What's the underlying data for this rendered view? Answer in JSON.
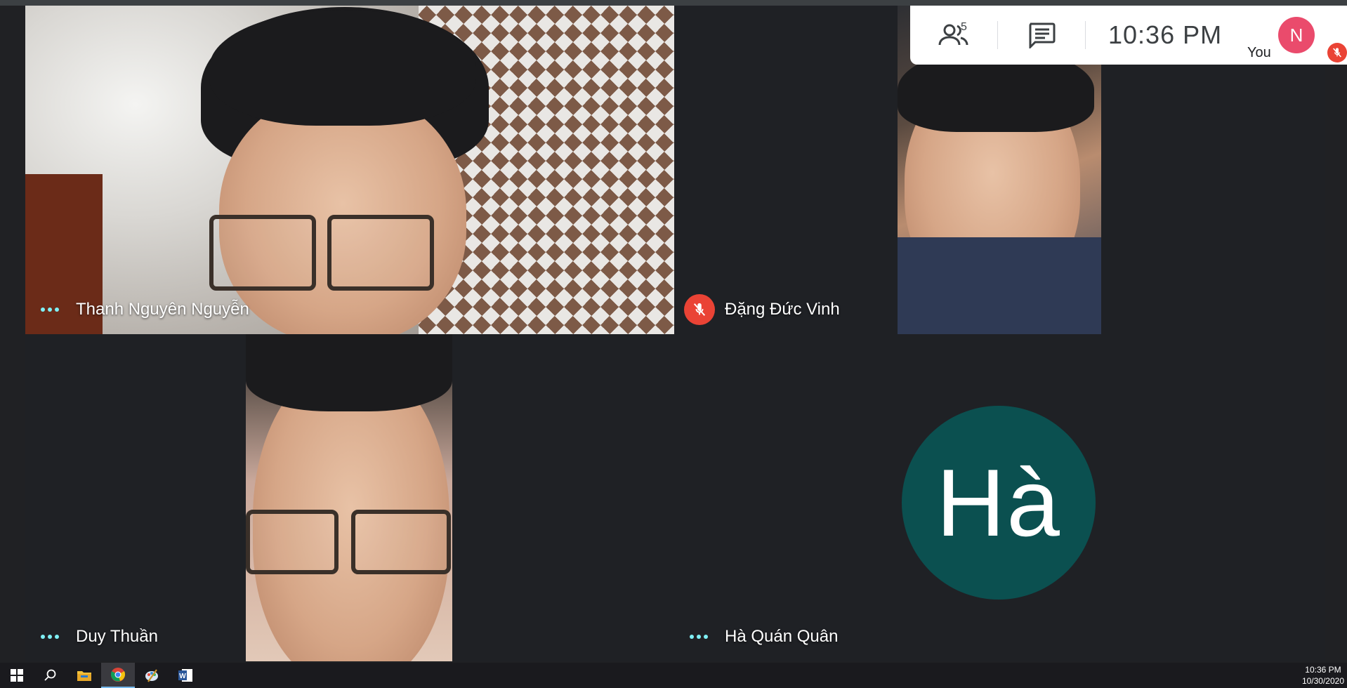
{
  "meeting": {
    "participants_count": "5",
    "time": "10:36  PM",
    "you_label": "You",
    "you_initial": "N"
  },
  "tiles": [
    {
      "name": "Thanh Nguyên Nguyễn",
      "muted": false
    },
    {
      "name": "Đặng Đức Vinh",
      "muted": true
    },
    {
      "name": "Duy Thuần",
      "muted": false
    },
    {
      "name": "Hà Quán Quân",
      "muted": false,
      "avatar_text": "Hà",
      "avatar_color": "#0b5050"
    }
  ],
  "taskbar": {
    "time": "10:36 PM",
    "date": "10/30/2020",
    "apps": [
      "windows-start",
      "search",
      "file-explorer",
      "chrome",
      "paint",
      "word"
    ]
  },
  "colors": {
    "background": "#202124",
    "accent_dots": "#7ff0f5",
    "mute_red": "#ea4335",
    "you_avatar": "#ea4b6c"
  }
}
